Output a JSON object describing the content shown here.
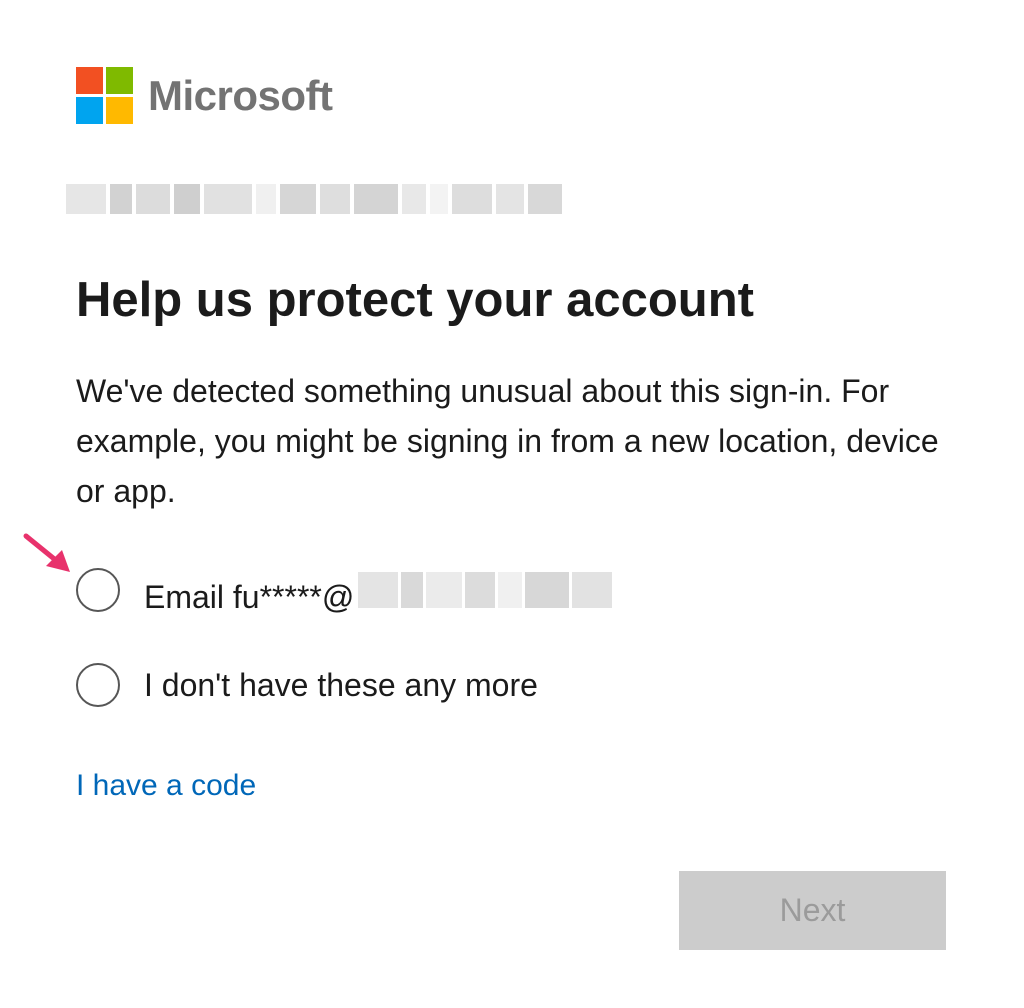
{
  "brand": {
    "name": "Microsoft",
    "logo_colors": [
      "#f25022",
      "#7fba00",
      "#00a4ef",
      "#ffb900"
    ]
  },
  "header": {
    "title": "Help us protect your account"
  },
  "main": {
    "description": "We've detected something unusual about this sign-in. For example, you might be signing in from a new location, device or app.",
    "options": [
      {
        "label": "Email fu*****@",
        "selected": false
      },
      {
        "label": "I don't have these any more",
        "selected": false
      }
    ],
    "code_link": "I have a code",
    "next_button": "Next"
  },
  "colors": {
    "link": "#0067b8",
    "annotation_arrow": "#e8326c",
    "button_disabled_bg": "#cccccc",
    "button_disabled_text": "#9b9b9b"
  }
}
